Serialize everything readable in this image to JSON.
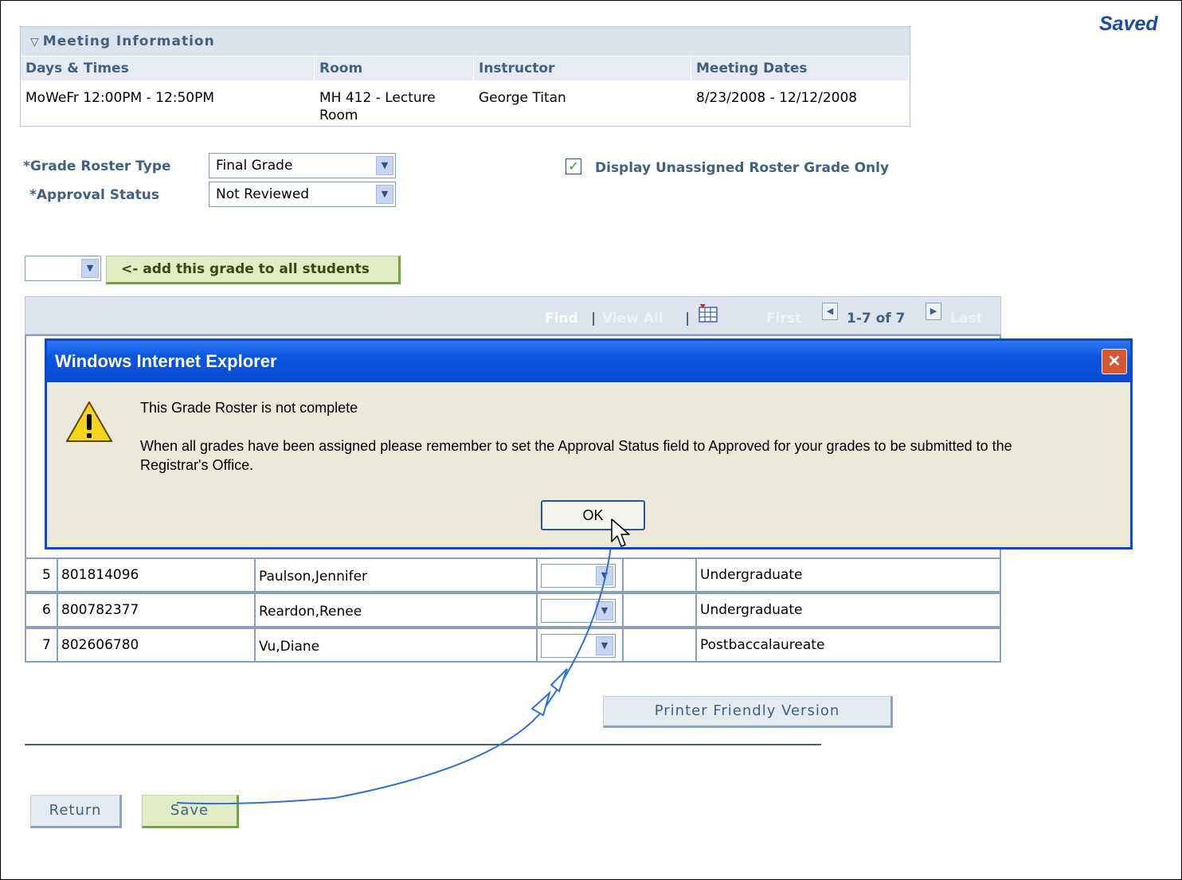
{
  "status": {
    "saved": "Saved"
  },
  "meeting": {
    "title": "Meeting Information",
    "headers": [
      "Days & Times",
      "Room",
      "Instructor",
      "Meeting Dates"
    ],
    "row": {
      "days_times": "MoWeFr 12:00PM - 12:50PM",
      "room_line1": "MH 412 - Lecture",
      "room_line2": "Room",
      "instructor": "George Titan",
      "dates": "8/23/2008 - 12/12/2008"
    }
  },
  "form": {
    "roster_type_label": "*Grade Roster Type",
    "roster_type_value": "Final Grade",
    "approval_label": "*Approval Status",
    "approval_value": "Not Reviewed",
    "display_unassigned_label": "Display Unassigned Roster Grade Only",
    "display_unassigned_checked": true,
    "add_grade_button": "<- add this grade to all students"
  },
  "grid_nav": {
    "find": "Find",
    "view_all": "View All",
    "first": "First",
    "range": "1-7 of 7",
    "last": "Last"
  },
  "rows": [
    {
      "num": "5",
      "id": "801814096",
      "name": "Paulson,Jennifer",
      "level": "Undergraduate"
    },
    {
      "num": "6",
      "id": "800782377",
      "name": "Reardon,Renee",
      "level": "Undergraduate"
    },
    {
      "num": "7",
      "id": "802606780",
      "name": "Vu,Diane",
      "level": "Postbaccalaureate"
    }
  ],
  "buttons": {
    "printer": "Printer Friendly Version",
    "return": "Return",
    "save": "Save"
  },
  "dialog": {
    "title": "Windows Internet Explorer",
    "line1": "This Grade Roster is not complete",
    "line2a": "When all grades have been assigned please remember to set the Approval Status field to Approved for your grades to be submitted to the",
    "line2b": "Registrar's Office.",
    "ok": "OK"
  },
  "colors": {
    "accent": "#43617e",
    "saved": "#1a4bb3",
    "dialog_title": "#0b55e0",
    "save_button": "#e2ecc5"
  }
}
